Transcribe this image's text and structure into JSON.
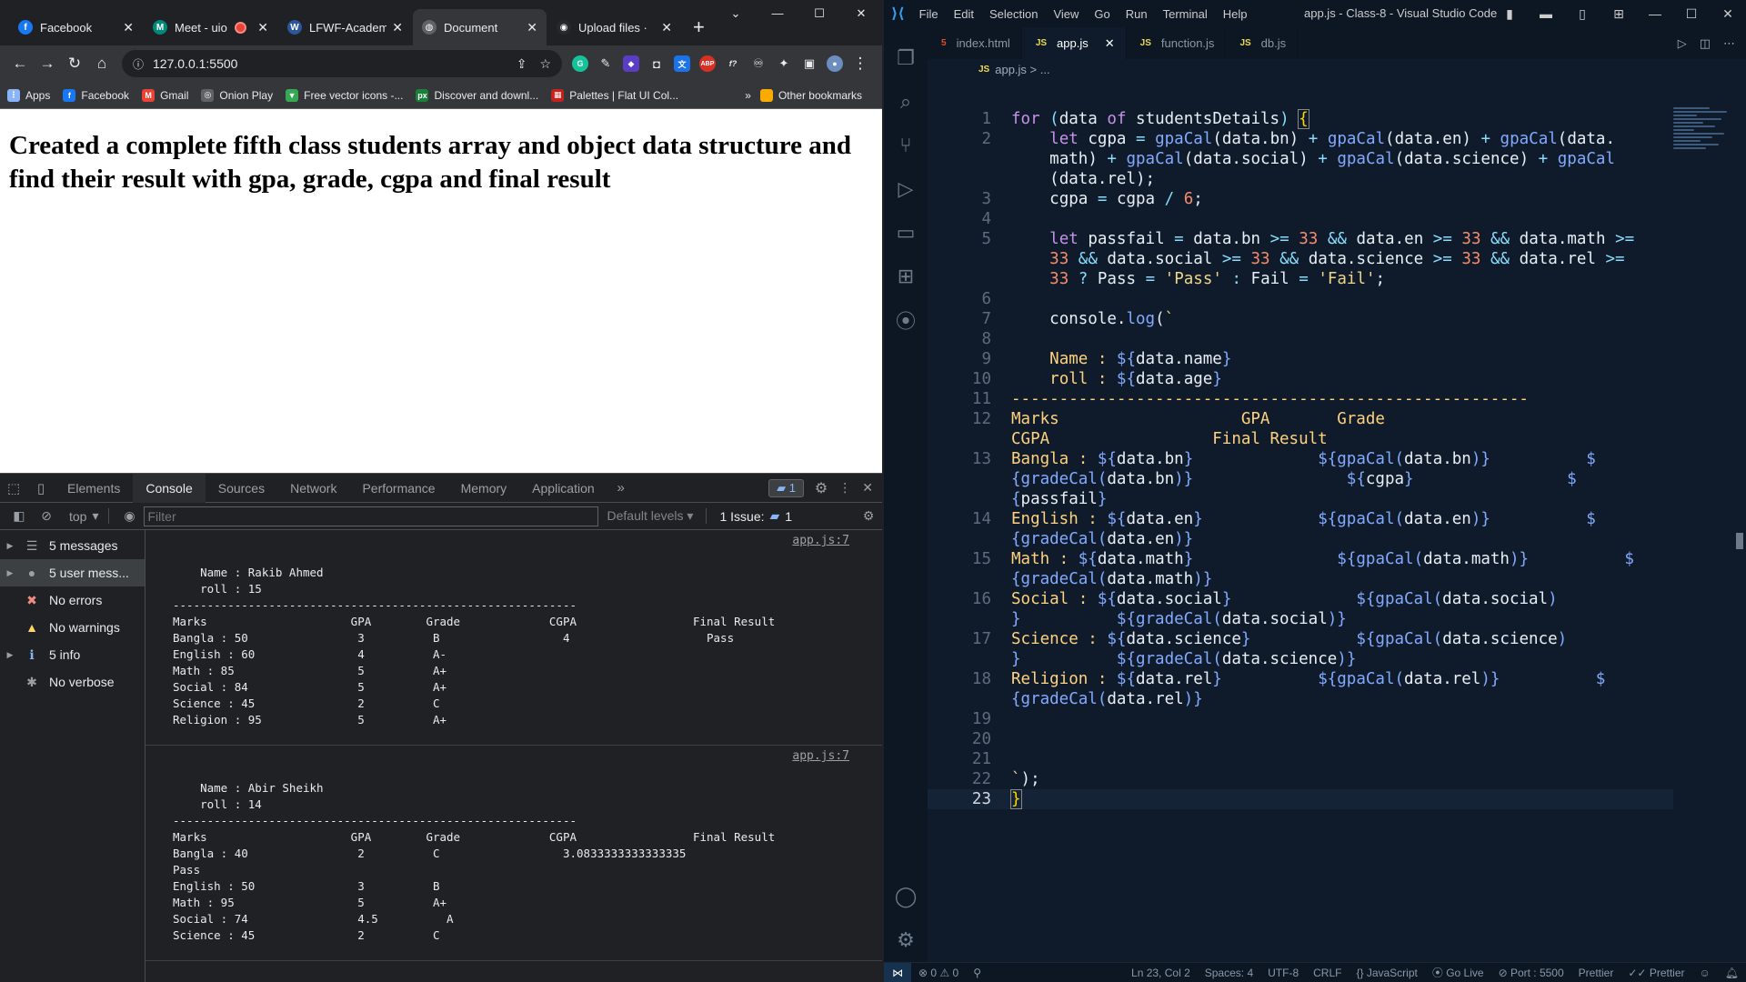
{
  "chrome": {
    "tabs": [
      {
        "label": "Facebook",
        "icon": "facebook-icon",
        "color": "#1877f2",
        "glyph": "f"
      },
      {
        "label": "Meet - uio",
        "icon": "meet-icon",
        "color": "#00897b",
        "glyph": "M",
        "recording": true
      },
      {
        "label": "LFWF-Academ",
        "icon": "lfwf-icon",
        "color": "#2b579a",
        "glyph": "W"
      },
      {
        "label": "Document",
        "icon": "document-icon",
        "color": "#5f6368",
        "glyph": "◍",
        "active": true
      },
      {
        "label": "Upload files · ",
        "icon": "github-icon",
        "color": "#24292e",
        "glyph": "◉"
      }
    ],
    "address": "127.0.0.1:5500",
    "bookmarks": [
      {
        "label": "Apps",
        "icon": "apps-grid-icon",
        "color": "#8ab4f8",
        "glyph": "⋮"
      },
      {
        "label": "Facebook",
        "icon": "facebook-icon",
        "color": "#1877f2",
        "glyph": "f"
      },
      {
        "label": "Gmail",
        "icon": "gmail-icon",
        "color": "#ea4335",
        "glyph": "M"
      },
      {
        "label": "Onion Play",
        "icon": "onion-icon",
        "color": "#5f6368",
        "glyph": "◎"
      },
      {
        "label": "Free vector icons -...",
        "icon": "vector-icon",
        "color": "#34a853",
        "glyph": "▼"
      },
      {
        "label": "Discover and downl...",
        "icon": "px-icon",
        "color": "#188038",
        "glyph": "px"
      },
      {
        "label": "Palettes | Flat UI Col...",
        "icon": "palette-icon",
        "color": "#c5221f",
        "glyph": "▦"
      }
    ],
    "other_bookmarks": "Other bookmarks",
    "heading": "Created a complete fifth class students array and object data structure and find their result with gpa, grade, cgpa and final result"
  },
  "devtools": {
    "tabs": [
      "Elements",
      "Console",
      "Sources",
      "Network",
      "Performance",
      "Memory",
      "Application"
    ],
    "active_tab": "Console",
    "message_badge": "1",
    "context": "top",
    "filter_placeholder": "Filter",
    "default_levels": "Default levels",
    "issues_label": "1 Issue:",
    "issues_count": "1",
    "sidebar": [
      {
        "label": "5 messages",
        "icon": "list-icon",
        "color": "#9aa0a6",
        "glyph": "☰",
        "arrow": "▶"
      },
      {
        "label": "5 user mess...",
        "icon": "user-icon",
        "color": "#9aa0a6",
        "glyph": "●",
        "arrow": "▶",
        "selected": true
      },
      {
        "label": "No errors",
        "icon": "error-icon",
        "color": "#f28b82",
        "glyph": "✖",
        "arrow": ""
      },
      {
        "label": "No warnings",
        "icon": "warning-icon",
        "color": "#fdd663",
        "glyph": "▲",
        "arrow": ""
      },
      {
        "label": "5 info",
        "icon": "info-icon",
        "color": "#8ab4f8",
        "glyph": "ℹ",
        "arrow": "▶"
      },
      {
        "label": "No verbose",
        "icon": "bug-icon",
        "color": "#9aa0a6",
        "glyph": "✱",
        "arrow": ""
      }
    ],
    "logs": [
      {
        "source": "app.js:7",
        "text": "\n    Name : Rakib Ahmed\n    roll : 15\n-----------------------------------------------------------\nMarks                     GPA        Grade             CGPA                 Final Result\nBangla : 50                3          B                  4                    Pass\nEnglish : 60               4          A-\nMath : 85                  5          A+\nSocial : 84                5          A+\nScience : 45               2          C\nReligion : 95              5          A+\n"
      },
      {
        "source": "app.js:7",
        "text": "\n    Name : Abir Sheikh\n    roll : 14\n-----------------------------------------------------------\nMarks                     GPA        Grade             CGPA                 Final Result\nBangla : 40                2          C                  3.0833333333333335\nPass\nEnglish : 50               3          B\nMath : 95                  5          A+\nSocial : 74                4.5          A\nScience : 45               2          C"
      }
    ]
  },
  "vscode": {
    "menu": [
      "File",
      "Edit",
      "Selection",
      "View",
      "Go",
      "Run",
      "Terminal",
      "Help"
    ],
    "window_title": "app.js - Class-8 - Visual Studio Code",
    "tabs": [
      {
        "label": "index.html",
        "icon": "html-file-icon",
        "color": "#e44d26",
        "glyph": "5"
      },
      {
        "label": "app.js",
        "icon": "js-file-icon",
        "color": "#f0db4f",
        "glyph": "JS",
        "active": true
      },
      {
        "label": "function.js",
        "icon": "js-file-icon",
        "color": "#f0db4f",
        "glyph": "JS"
      },
      {
        "label": "db.js",
        "icon": "js-file-icon",
        "color": "#f0db4f",
        "glyph": "JS"
      }
    ],
    "breadcrumb": "app.js > ...",
    "code_lines": [
      {
        "n": "1",
        "html": "<span class='k'>for</span> <span class='o'>(</span><span class='v'>data</span> <span class='k'>of</span> <span class='v'>studentsDetails</span><span class='o'>)</span> <span class='br'>{</span>"
      },
      {
        "n": "2",
        "html": "    <span class='k'>let</span> <span class='v'>cgpa</span> <span class='o'>=</span> <span class='f'>gpaCal</span>(<span class='v'>data</span>.<span class='v'>bn</span>) <span class='o'>+</span> <span class='f'>gpaCal</span>(<span class='v'>data</span>.<span class='v'>en</span>) <span class='o'>+</span> <span class='f'>gpaCal</span>(<span class='v'>data</span>."
      },
      {
        "n": "",
        "html": "    <span class='v'>math</span>) <span class='o'>+</span> <span class='f'>gpaCal</span>(<span class='v'>data</span>.<span class='v'>social</span>) <span class='o'>+</span> <span class='f'>gpaCal</span>(<span class='v'>data</span>.<span class='v'>science</span>) <span class='o'>+</span> <span class='f'>gpaCal</span>"
      },
      {
        "n": "",
        "html": "    (<span class='v'>data</span>.<span class='v'>rel</span>);"
      },
      {
        "n": "3",
        "html": "    <span class='v'>cgpa</span> <span class='o'>=</span> <span class='v'>cgpa</span> <span class='o'>/</span> <span class='n'>6</span>;"
      },
      {
        "n": "4",
        "html": ""
      },
      {
        "n": "5",
        "html": "    <span class='k'>let</span> <span class='v'>passfail</span> <span class='o'>=</span> <span class='v'>data</span>.<span class='v'>bn</span> <span class='o'>&gt;=</span> <span class='n'>33</span> <span class='o'>&amp;&amp;</span> <span class='v'>data</span>.<span class='v'>en</span> <span class='o'>&gt;=</span> <span class='n'>33</span> <span class='o'>&amp;&amp;</span> <span class='v'>data</span>.<span class='v'>math</span> <span class='o'>&gt;=</span>"
      },
      {
        "n": "",
        "html": "    <span class='n'>33</span> <span class='o'>&amp;&amp;</span> <span class='v'>data</span>.<span class='v'>social</span> <span class='o'>&gt;=</span> <span class='n'>33</span> <span class='o'>&amp;&amp;</span> <span class='v'>data</span>.<span class='v'>science</span> <span class='o'>&gt;=</span> <span class='n'>33</span> <span class='o'>&amp;&amp;</span> <span class='v'>data</span>.<span class='v'>rel</span> <span class='o'>&gt;=</span>"
      },
      {
        "n": "",
        "html": "    <span class='n'>33</span> <span class='o'>?</span> <span class='v'>Pass</span> <span class='o'>=</span> <span class='s'>'Pass'</span> <span class='o'>:</span> <span class='v'>Fail</span> <span class='o'>=</span> <span class='s'>'Fail'</span>;"
      },
      {
        "n": "6",
        "html": ""
      },
      {
        "n": "7",
        "html": "    <span class='v'>console</span>.<span class='f'>log</span>(<span class='s'>`</span>"
      },
      {
        "n": "8",
        "html": ""
      },
      {
        "n": "9",
        "html": "    <span class='t'>Name : </span><span class='f'>${</span><span class='v'>data</span>.<span class='v'>name</span><span class='f'>}</span>"
      },
      {
        "n": "10",
        "html": "    <span class='t'>roll : </span><span class='f'>${</span><span class='v'>data</span>.<span class='v'>age</span><span class='f'>}</span>"
      },
      {
        "n": "11",
        "html": "<span class='t'>------------------------------------------------------</span>"
      },
      {
        "n": "12",
        "html": "<span class='t'>Marks                   GPA       Grade</span>"
      },
      {
        "n": "",
        "html": "<span class='t'>CGPA                 Final Result</span>"
      },
      {
        "n": "13",
        "html": "<span class='t'>Bangla : </span><span class='f'>${</span><span class='v'>data</span>.<span class='v'>bn</span><span class='f'>}</span>             <span class='f'>${gpaCal(</span><span class='v'>data</span>.<span class='v'>bn</span><span class='f'>)}</span>          <span class='f'>$</span>"
      },
      {
        "n": "",
        "html": "<span class='f'>{gradeCal(</span><span class='v'>data</span>.<span class='v'>bn</span><span class='f'>)}</span>                <span class='f'>${</span><span class='v'>cgpa</span><span class='f'>}</span>                <span class='f'>$</span>"
      },
      {
        "n": "",
        "html": "<span class='f'>{</span><span class='v'>passfail</span><span class='f'>}</span>"
      },
      {
        "n": "14",
        "html": "<span class='t'>English : </span><span class='f'>${</span><span class='v'>data</span>.<span class='v'>en</span><span class='f'>}</span>            <span class='f'>${gpaCal(</span><span class='v'>data</span>.<span class='v'>en</span><span class='f'>)}</span>          <span class='f'>$</span>"
      },
      {
        "n": "",
        "html": "<span class='f'>{gradeCal(</span><span class='v'>data</span>.<span class='v'>en</span><span class='f'>)}</span>"
      },
      {
        "n": "15",
        "html": "<span class='t'>Math : </span><span class='f'>${</span><span class='v'>data</span>.<span class='v'>math</span><span class='f'>}</span>               <span class='f'>${gpaCal(</span><span class='v'>data</span>.<span class='v'>math</span><span class='f'>)}</span>          <span class='f'>$</span>"
      },
      {
        "n": "",
        "html": "<span class='f'>{gradeCal(</span><span class='v'>data</span>.<span class='v'>math</span><span class='f'>)}</span>"
      },
      {
        "n": "16",
        "html": "<span class='t'>Social : </span><span class='f'>${</span><span class='v'>data</span>.<span class='v'>social</span><span class='f'>}</span>             <span class='f'>${gpaCal(</span><span class='v'>data</span>.<span class='v'>social</span><span class='f'>)</span>"
      },
      {
        "n": "",
        "html": "<span class='f'>}</span>          <span class='f'>${gradeCal(</span><span class='v'>data</span>.<span class='v'>social</span><span class='f'>)}</span>"
      },
      {
        "n": "17",
        "html": "<span class='t'>Science : </span><span class='f'>${</span><span class='v'>data</span>.<span class='v'>science</span><span class='f'>}</span>           <span class='f'>${gpaCal(</span><span class='v'>data</span>.<span class='v'>science</span><span class='f'>)</span>"
      },
      {
        "n": "",
        "html": "<span class='f'>}</span>          <span class='f'>${gradeCal(</span><span class='v'>data</span>.<span class='v'>science</span><span class='f'>)}</span>"
      },
      {
        "n": "18",
        "html": "<span class='t'>Religion : </span><span class='f'>${</span><span class='v'>data</span>.<span class='v'>rel</span><span class='f'>}</span>          <span class='f'>${gpaCal(</span><span class='v'>data</span>.<span class='v'>rel</span><span class='f'>)}</span>          <span class='f'>$</span>"
      },
      {
        "n": "",
        "html": "<span class='f'>{gradeCal(</span><span class='v'>data</span>.<span class='v'>rel</span><span class='f'>)}</span>"
      },
      {
        "n": "19",
        "html": ""
      },
      {
        "n": "20",
        "html": ""
      },
      {
        "n": "21",
        "html": ""
      },
      {
        "n": "22",
        "html": "<span class='s'>`</span>);"
      },
      {
        "n": "23",
        "html": "<span class='br'>}</span>",
        "current": true
      }
    ],
    "status": {
      "errors": "0",
      "warnings": "0",
      "position": "Ln 23, Col 2",
      "spaces": "Spaces: 4",
      "encoding": "UTF-8",
      "eol": "CRLF",
      "language": "JavaScript",
      "go_live": "Go Live",
      "port": "Port : 5500",
      "prettier1": "Prettier",
      "prettier2": "Prettier"
    }
  }
}
